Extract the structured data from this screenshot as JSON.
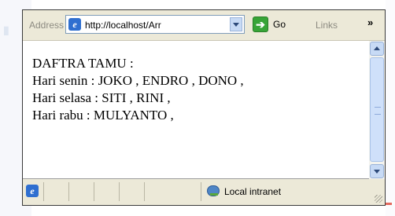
{
  "browser": {
    "address_label": "Address",
    "url": "http://localhost/Arr",
    "go_label": "Go",
    "links_label": "Links",
    "more_chevron": "»"
  },
  "page": {
    "lines": [
      "DAFTRA TAMU :",
      "Hari senin : JOKO , ENDRO , DONO ,",
      "Hari selasa : SITI , RINI ,",
      "Hari rabu : MULYANTO ,"
    ]
  },
  "status": {
    "zone_label": "Local intranet"
  },
  "colors": {
    "chrome": "#ece9d8",
    "accent": "#2f6fd0",
    "go_green": "#37a437"
  },
  "icons": [
    "ie-page-icon",
    "go-arrow-icon",
    "local-intranet-icon",
    "scroll-up-arrow-icon",
    "scroll-down-arrow-icon"
  ]
}
